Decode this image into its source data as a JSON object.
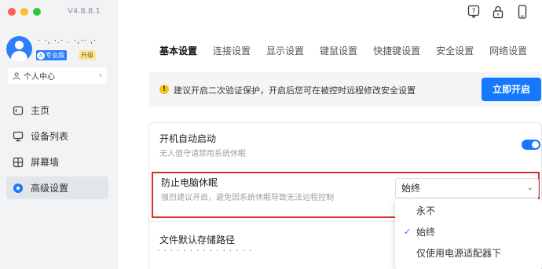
{
  "app": {
    "version": "V4.8.8.1"
  },
  "user": {
    "name_masked": "· ·, ·.·  .  ·,·· ,·",
    "badge_pro": "专业版",
    "badge_pro_icon": "A",
    "badge_upgrade": "升级",
    "personal_center": "个人中心"
  },
  "sidebar": {
    "items": [
      {
        "label": "主页",
        "icon": "home-icon"
      },
      {
        "label": "设备列表",
        "icon": "monitor-icon"
      },
      {
        "label": "屏幕墙",
        "icon": "grid-icon"
      },
      {
        "label": "高级设置",
        "icon": "gear-icon",
        "active": true
      }
    ]
  },
  "tabs": [
    "基本设置",
    "连接设置",
    "显示设置",
    "键鼠设置",
    "快捷键设置",
    "安全设置",
    "网络设置"
  ],
  "notice": {
    "icon": "!",
    "text": "建议开启二次验证保护，开启后您可在被控时远程修改安全设置",
    "button": "立即开启"
  },
  "settings": {
    "autostart": {
      "title": "开机自动启动",
      "desc": "无人值守请禁用系统休眠"
    },
    "prevent_sleep": {
      "title": "防止电脑休眠",
      "desc": "强烈建议开启，避免因系统休眠导致无法远程控制",
      "selected": "始终",
      "options": [
        "永不",
        "始终",
        "仅使用电源适配器下"
      ]
    },
    "default_path": {
      "title": "文件默认存储路径",
      "value_masked": "·  ·  ·  ·  ·  ·  · ·  ·  · ·  ·  · · ·"
    }
  },
  "colors": {
    "accent": "#1677ff",
    "highlight_box": "#d93025"
  }
}
